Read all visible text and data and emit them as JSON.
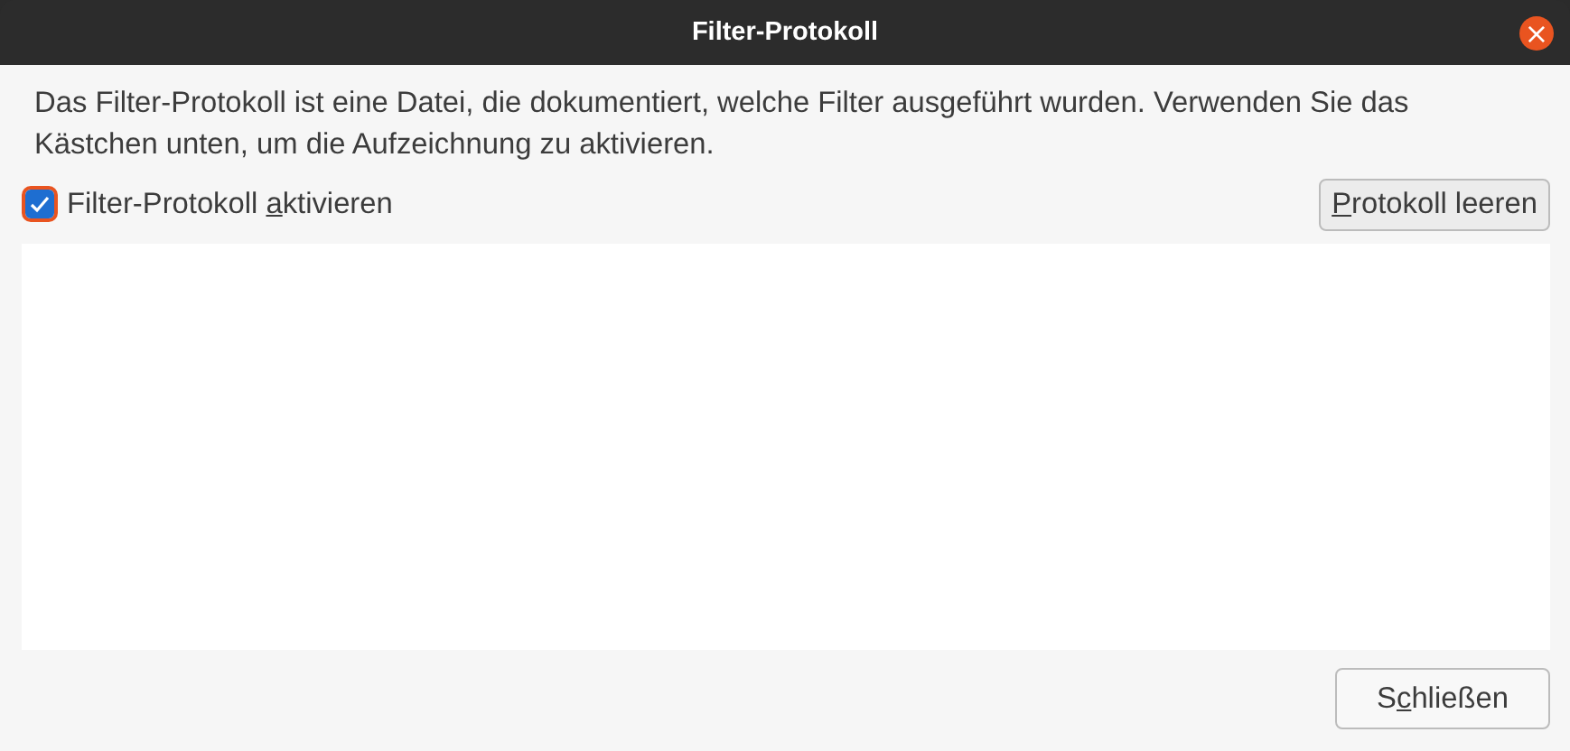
{
  "window": {
    "title": "Filter-Protokoll",
    "close_glyph": "×"
  },
  "description": "Das Filter-Protokoll ist eine Datei, die dokumentiert, welche Filter ausgeführt wurden. Verwenden Sie das Kästchen unten, um die Aufzeichnung zu aktivieren.",
  "checkbox": {
    "label_before": "Filter-Protokoll ",
    "mnemonic": "a",
    "label_after": "ktivieren",
    "checked": true
  },
  "clear_button": {
    "mnemonic": "P",
    "label_after": "rotokoll leeren"
  },
  "close_button": {
    "label_before": "S",
    "mnemonic": "c",
    "label_after": "hließen"
  }
}
